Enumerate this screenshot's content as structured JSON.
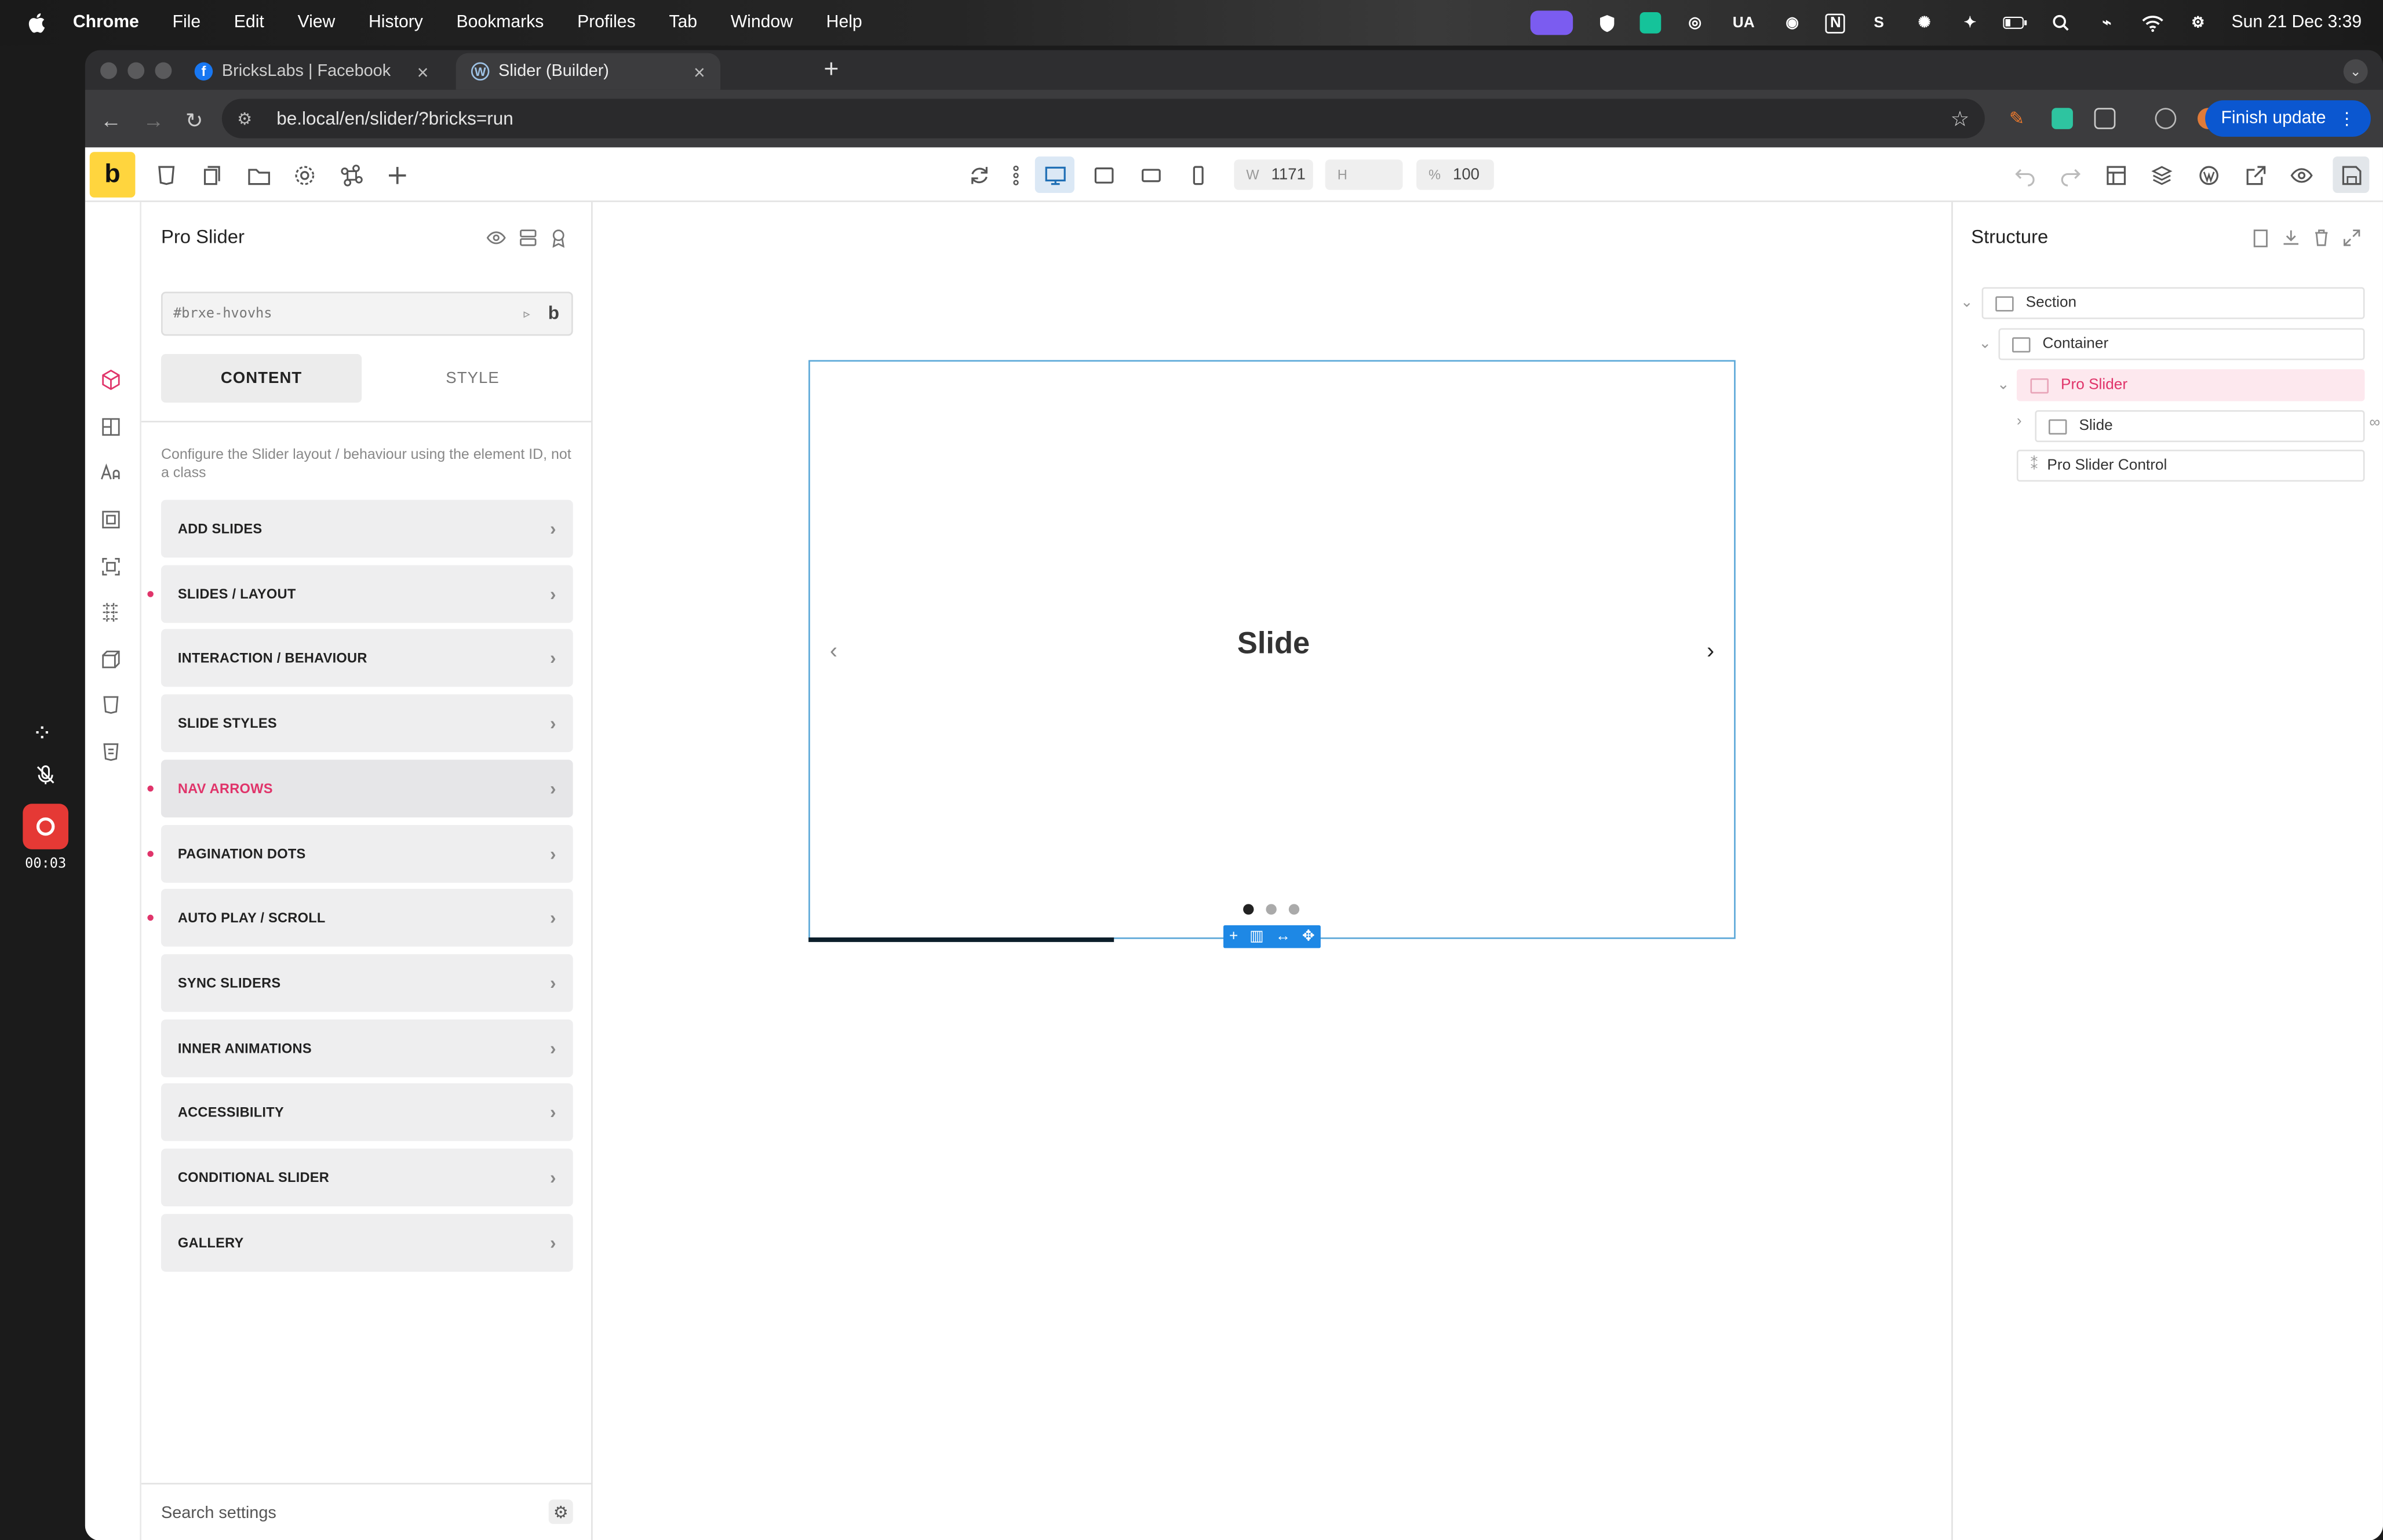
{
  "menubar": {
    "app": "Chrome",
    "items": [
      "File",
      "Edit",
      "View",
      "History",
      "Bookmarks",
      "Profiles",
      "Tab",
      "Window",
      "Help"
    ],
    "status_text": "UA",
    "clock": "Sun 21 Dec  3:39"
  },
  "browser": {
    "tabs": [
      {
        "title": "BricksLabs | Facebook",
        "icon": "facebook-icon"
      },
      {
        "title": "Slider (Builder)",
        "icon": "wordpress-icon"
      }
    ],
    "url": "be.local/en/slider/?bricks=run",
    "finish_update": "Finish update"
  },
  "builder": {
    "logo": "b",
    "width_label": "W",
    "width_value": "1171",
    "height_label": "H",
    "height_value": "",
    "zoom_label": "%",
    "zoom_value": "100"
  },
  "panel": {
    "title": "Pro Slider",
    "id_placeholder": "#brxe-hvovhs",
    "id_button": "b",
    "tabs": [
      "CONTENT",
      "STYLE"
    ],
    "description": "Configure the Slider layout / behaviour using the element ID, not a class",
    "sections": [
      {
        "label": "ADD SLIDES",
        "modified": false,
        "active": false
      },
      {
        "label": "SLIDES / LAYOUT",
        "modified": true,
        "active": false
      },
      {
        "label": "INTERACTION / BEHAVIOUR",
        "modified": false,
        "active": false
      },
      {
        "label": "SLIDE STYLES",
        "modified": false,
        "active": false
      },
      {
        "label": "NAV ARROWS",
        "modified": true,
        "active": true
      },
      {
        "label": "PAGINATION DOTS",
        "modified": true,
        "active": false
      },
      {
        "label": "AUTO PLAY / SCROLL",
        "modified": true,
        "active": false
      },
      {
        "label": "SYNC SLIDERS",
        "modified": false,
        "active": false
      },
      {
        "label": "INNER ANIMATIONS",
        "modified": false,
        "active": false
      },
      {
        "label": "ACCESSIBILITY",
        "modified": false,
        "active": false
      },
      {
        "label": "CONDITIONAL SLIDER",
        "modified": false,
        "active": false
      },
      {
        "label": "GALLERY",
        "modified": false,
        "active": false
      }
    ],
    "search_placeholder": "Search settings"
  },
  "canvas": {
    "slide_text": "Slide",
    "prev_arrow": "‹",
    "next_arrow": "›",
    "pagination_count": 3,
    "active_dot": 1,
    "autoplay_progress_fraction": 0.33
  },
  "structure": {
    "title": "Structure",
    "nodes": [
      "Section",
      "Container",
      "Pro Slider",
      "Slide",
      "Pro Slider Control"
    ],
    "selected": "Pro Slider"
  },
  "recorder": {
    "time": "00:03"
  },
  "colors": {
    "accent_pink": "#e0346a",
    "bricks_yellow": "#ffd53e",
    "chrome_blue": "#0b57d0",
    "selection_blue": "#1e88e5",
    "record_red": "#e53935"
  }
}
